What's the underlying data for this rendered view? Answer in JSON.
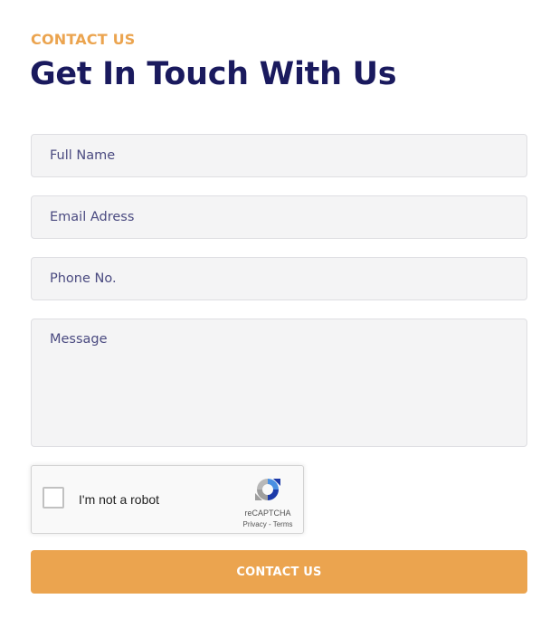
{
  "header": {
    "eyebrow": "CONTACT US",
    "title": "Get In Touch With Us"
  },
  "form": {
    "full_name_placeholder": "Full Name",
    "email_placeholder": "Email Adress",
    "phone_placeholder": "Phone No.",
    "message_placeholder": "Message",
    "submit_label": "CONTACT US"
  },
  "recaptcha": {
    "checkbox_label": "I'm not a robot",
    "brand": "reCAPTCHA",
    "privacy_link": "Privacy",
    "separator": " - ",
    "terms_link": "Terms",
    "icon": "recaptcha-logo-icon"
  },
  "colors": {
    "accent": "#eba44f",
    "heading": "#1a1a5e",
    "field_background": "#f4f4f5",
    "field_border": "#dedee2",
    "placeholder_text": "#4a4a80"
  }
}
